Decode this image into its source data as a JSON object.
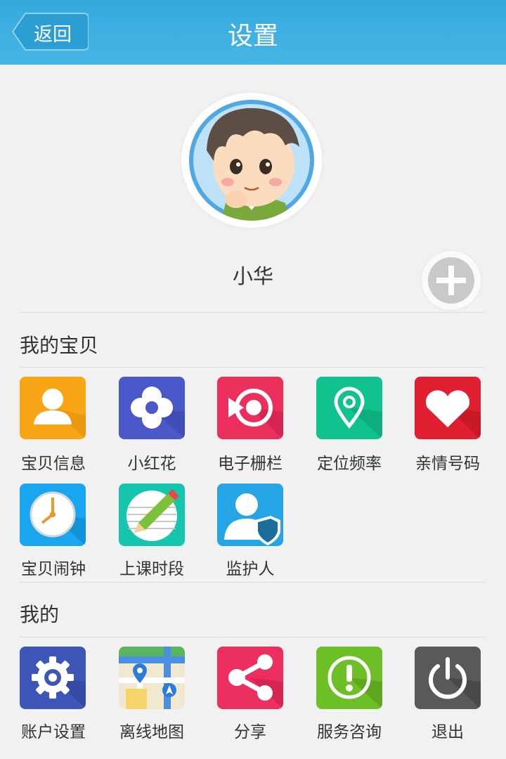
{
  "header": {
    "back_label": "返回",
    "title": "设置"
  },
  "profile": {
    "name": "小华"
  },
  "sections": {
    "baby": {
      "title": "我的宝贝",
      "items": [
        "宝贝信息",
        "小红花",
        "电子栅栏",
        "定位频率",
        "亲情号码",
        "宝贝闹钟",
        "上课时段",
        "监护人"
      ]
    },
    "mine": {
      "title": "我的",
      "items": [
        "账户设置",
        "离线地图",
        "分享",
        "服务咨询",
        "退出"
      ]
    }
  },
  "colors": {
    "header": "#3aaee0",
    "tiles": [
      "#f8a516",
      "#4a58c9",
      "#ec2f5c",
      "#10c28d",
      "#e01f30",
      "#19a6ef",
      "#16c5ad",
      "#25a5e6",
      "#3e56b8",
      "#f0e9d0",
      "#ed2f60",
      "#6cbf26",
      "#595959"
    ]
  }
}
